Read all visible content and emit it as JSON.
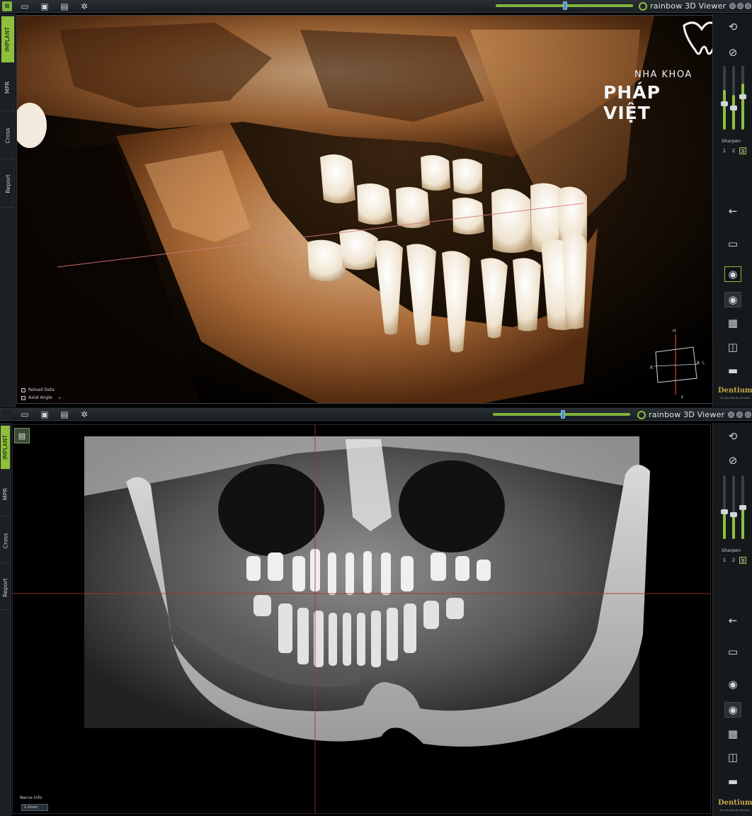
{
  "app": {
    "brand_name": "rainbow 3D Viewer",
    "accent_color": "#8fbf3d",
    "slider_color": "#7fb23a",
    "toolbar_icons": [
      "folder-open-icon",
      "open-archive-icon",
      "save-icon",
      "settings-gear-icon"
    ],
    "window_controls": [
      "minimize-icon",
      "restore-icon",
      "close-icon"
    ]
  },
  "tabs": [
    {
      "label": "IMPLANT",
      "active": true
    },
    {
      "label": "MPR",
      "active": false
    },
    {
      "label": "Cross",
      "active": false
    },
    {
      "label": "Report",
      "active": false
    }
  ],
  "top_view": {
    "mode": "3D volume render",
    "options": [
      {
        "label": "Reload Data",
        "checked": false
      },
      {
        "label": "Axial Angle",
        "checked": false
      }
    ],
    "plus_minus": "+ -",
    "orientation": {
      "top": "H",
      "bottom": "F",
      "left": "R",
      "right": "L",
      "front": "A"
    },
    "watermark": {
      "line1": "NHA KHOA",
      "line2": "PHÁP VIỆT"
    }
  },
  "bottom_view": {
    "mode": "Panoramic",
    "nerve_label": "Nerve Info",
    "nerve_value": "1.0mm"
  },
  "right_toolbar": {
    "sharpen_label": "Sharpen",
    "sharpen_options": [
      "1",
      "2",
      "3"
    ],
    "sharpen_selected": "3",
    "brand": "Dentium",
    "brand_sub": "For Dentists By Dentists",
    "top_icons": [
      "reset-rotation-icon",
      "reset-view-icon"
    ],
    "tool_icons": [
      "back-arrow-icon",
      "ruler-icon",
      "camera-capture-icon",
      "camera-icon",
      "print-layout-icon",
      "crop-icon",
      "more-icon"
    ]
  },
  "sliders": {
    "window_level": 0.68,
    "brightness": [
      0.62,
      0.55,
      0.72
    ]
  }
}
